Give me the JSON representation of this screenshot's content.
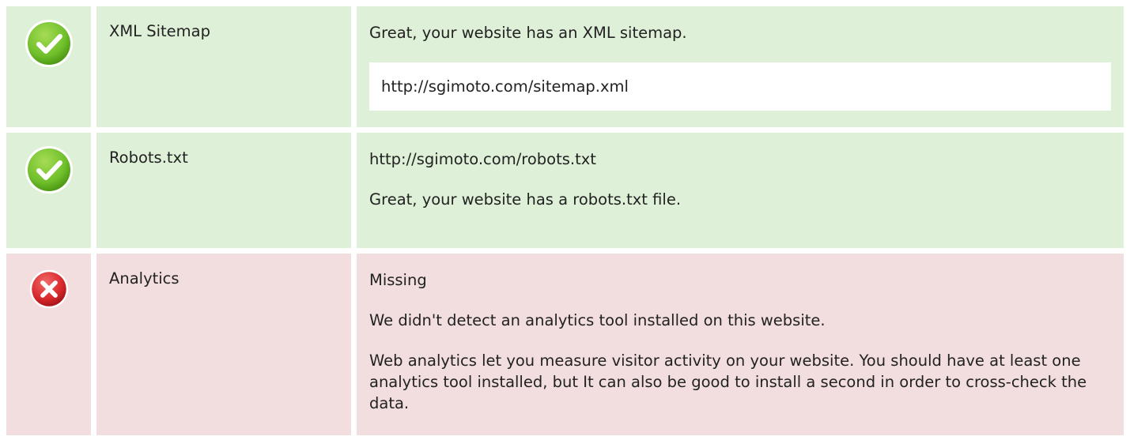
{
  "colors": {
    "pass_bg": "#dff0d8",
    "fail_bg": "#f2dede",
    "pass_icon": "#6fbf2a",
    "fail_icon": "#d8282b"
  },
  "rows": [
    {
      "status": "pass",
      "icon": "check-circle-icon",
      "name": "XML Sitemap",
      "message": "Great, your website has an XML sitemap.",
      "url": "http://sgimoto.com/sitemap.xml"
    },
    {
      "status": "pass",
      "icon": "check-circle-icon",
      "name": "Robots.txt",
      "url": "http://sgimoto.com/robots.txt",
      "message": "Great, your website has a robots.txt file."
    },
    {
      "status": "fail",
      "icon": "cross-circle-icon",
      "name": "Analytics",
      "result": "Missing",
      "message": "We didn't detect an analytics tool installed on this website.",
      "advice": "Web analytics let you measure visitor activity on your website. You should have at least one analytics tool installed, but It can also be good to install a second in order to cross-check the data."
    }
  ]
}
